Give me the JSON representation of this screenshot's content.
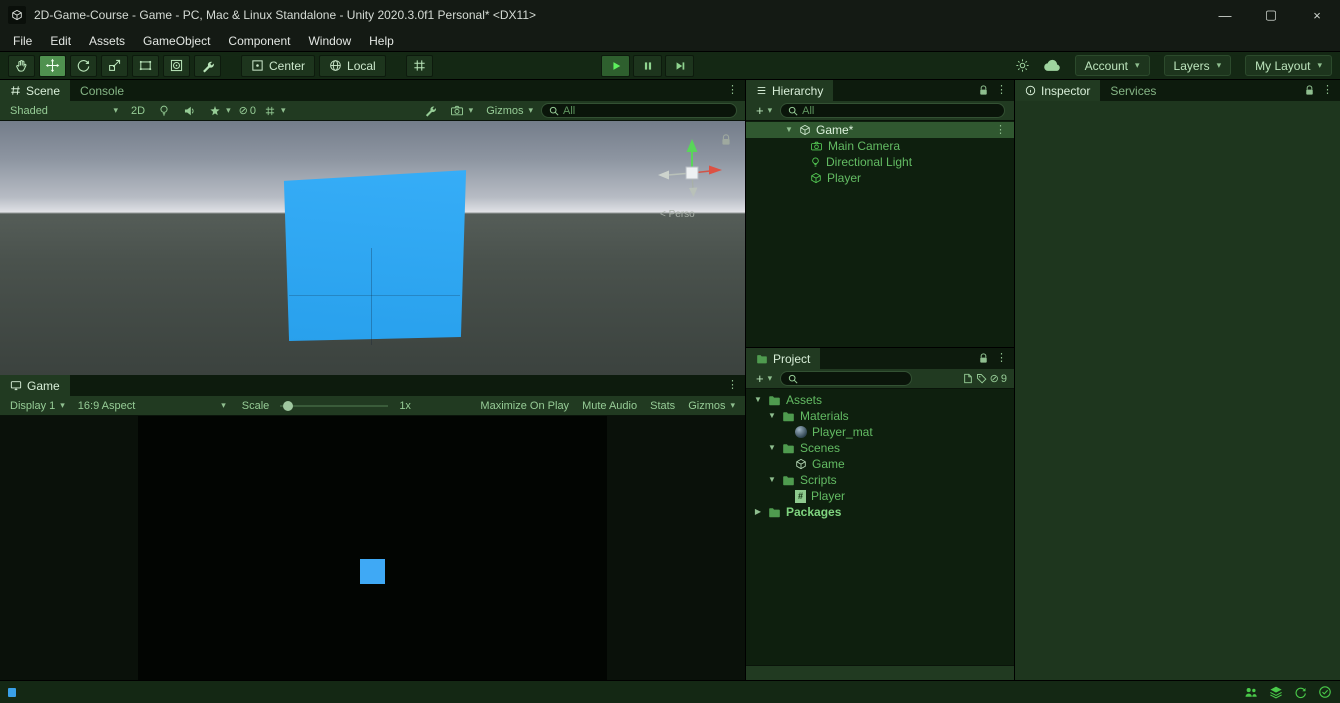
{
  "glyphs": {
    "dropdown": "▾",
    "kebab": "⋮",
    "plus": "+",
    "tree_open": "▼",
    "tree_closed": "▶",
    "minimize": "—",
    "maximize": "▢",
    "close": "×",
    "slash": "⊘",
    "script_hash": "#"
  },
  "window": {
    "title": "2D-Game-Course - Game - PC, Mac & Linux Standalone - Unity 2020.3.0f1 Personal* <DX11>"
  },
  "menu": {
    "items": [
      "File",
      "Edit",
      "Assets",
      "GameObject",
      "Component",
      "Window",
      "Help"
    ]
  },
  "toolbar": {
    "center": "Center",
    "local": "Local",
    "account": "Account",
    "layers": "Layers",
    "layout": "My Layout"
  },
  "scene": {
    "tab_scene": "Scene",
    "tab_console": "Console",
    "shading": "Shaded",
    "mode2d": "2D",
    "hidden_count": "0",
    "gizmos": "Gizmos",
    "search_placeholder": "All",
    "persp": "< Perso"
  },
  "game": {
    "tab": "Game",
    "display": "Display 1",
    "aspect": "16:9 Aspect",
    "scale_label": "Scale",
    "scale_value": "1x",
    "maximize_on_play": "Maximize On Play",
    "mute_audio": "Mute Audio",
    "stats": "Stats",
    "gizmos": "Gizmos"
  },
  "hierarchy": {
    "title": "Hierarchy",
    "search_placeholder": "All",
    "root": "Game*",
    "items": [
      {
        "label": "Main Camera"
      },
      {
        "label": "Directional Light"
      },
      {
        "label": "Player"
      }
    ]
  },
  "project": {
    "title": "Project",
    "hidden_count": "9",
    "tree": [
      {
        "label": "Assets"
      },
      {
        "label": "Materials"
      },
      {
        "label": "Player_mat"
      },
      {
        "label": "Scenes"
      },
      {
        "label": "Game"
      },
      {
        "label": "Scripts"
      },
      {
        "label": "Player"
      },
      {
        "label": "Packages"
      }
    ]
  },
  "inspector": {
    "tab_inspector": "Inspector",
    "tab_services": "Services"
  },
  "colors": {
    "accent_green": "#4caf50",
    "selection": "#305830",
    "cube_blue": "#2fa8f4"
  }
}
